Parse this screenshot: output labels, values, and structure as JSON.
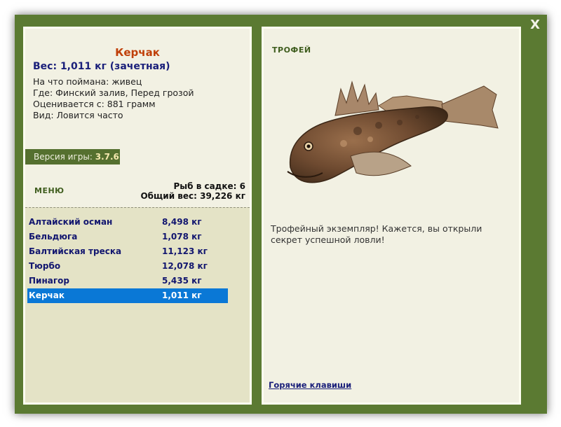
{
  "window": {
    "close_label": "X"
  },
  "left_panel": {
    "fish_name": "Керчак",
    "weight_line": "Вес: 1,011 кг (зачетная)",
    "info": [
      "На что поймана: живец",
      "Где: Финский залив, Перед грозой",
      "Оценивается с: 881 грамм",
      "Вид: Ловится часто"
    ],
    "version_label": "Версия игры:",
    "version_value": "3.7.6",
    "menu_label": "МЕНЮ",
    "fish_in_keepnet": "Рыб в садке: 6",
    "total_weight": "Общий вес: 39,226 кг",
    "fish_list": [
      {
        "name": "Алтайский осман",
        "weight": "8,498 кг"
      },
      {
        "name": "Бельдюга",
        "weight": "1,078 кг"
      },
      {
        "name": "Балтийская треска",
        "weight": "11,123 кг"
      },
      {
        "name": "Тюрбо",
        "weight": "12,078 кг"
      },
      {
        "name": "Пинагор",
        "weight": "5,435 кг"
      },
      {
        "name": "Керчак",
        "weight": "1,011 кг"
      }
    ],
    "selected_index": 5
  },
  "right_panel": {
    "trophy_label": "ТРОФЕЙ",
    "description": "Трофейный экземпляр! Кажется, вы открыли секрет успешной ловли!",
    "hotkeys_link": "Горячие клавиши"
  },
  "colors": {
    "frame": "#5b7a32",
    "selected_row": "#0a78d6",
    "fish_title": "#c0400a",
    "list_text": "#12166f"
  }
}
